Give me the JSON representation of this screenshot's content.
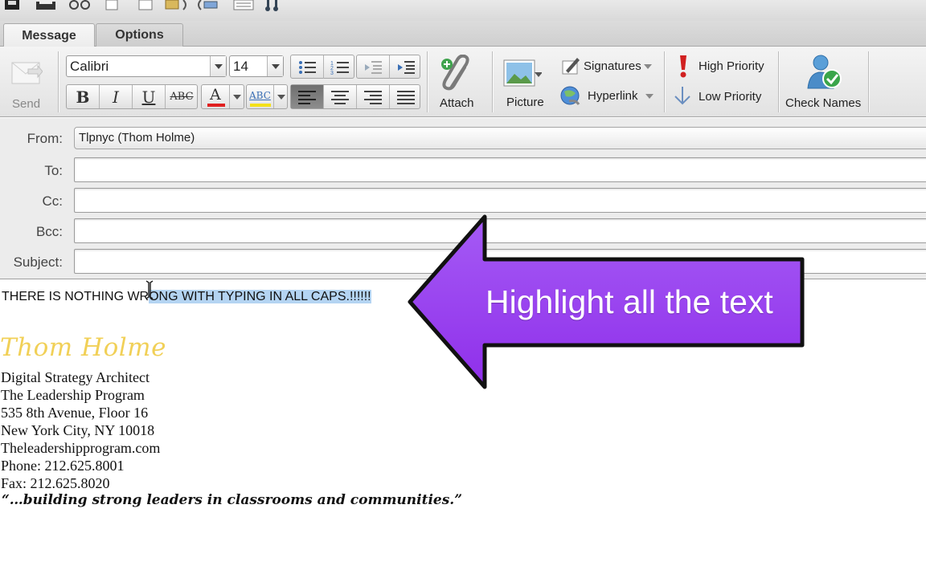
{
  "tabs": {
    "message": "Message",
    "options": "Options"
  },
  "ribbon": {
    "send": "Send",
    "font_name": "Calibri",
    "font_size": "14",
    "bold": "B",
    "italic": "I",
    "underline": "U",
    "strikethrough": "ABC",
    "font_color": "A",
    "highlight": "ABC",
    "attach": "Attach",
    "picture": "Picture",
    "signatures": "Signatures",
    "hyperlink": "Hyperlink",
    "high_priority": "High Priority",
    "low_priority": "Low Priority",
    "check_names": "Check Names",
    "colors": {
      "font_color_bar": "#e02020",
      "highlight_bar": "#f4e11a"
    }
  },
  "fields": {
    "from_label": "From:",
    "from_value": "Tlpnyc (Thom Holme)",
    "to_label": "To:",
    "cc_label": "Cc:",
    "bcc_label": "Bcc:",
    "subject_label": "Subject:"
  },
  "body": {
    "text_plain": "THERE IS NOTHING WR",
    "text_selected": "ONG WITH TYPING IN ALL CAPS.!!!!!!",
    "signature_name": "Thom Holme",
    "signature_lines": [
      "Digital Strategy Architect",
      "The Leadership Program",
      "535 8th Avenue, Floor 16",
      "New York City, NY 10018",
      "Theleadershipprogram.com",
      "Phone: 212.625.8001",
      "Fax: 212.625.8020"
    ],
    "signature_quote": "“…building strong leaders in classrooms and communities.”"
  },
  "callout": {
    "text": "Highlight all the text",
    "color": "#9b3ff0"
  },
  "icons": [
    "save-icon",
    "print-icon",
    "cut-icon",
    "copy-icon",
    "paste-icon",
    "paste-special-icon",
    "link-icon",
    "list-icon",
    "music-icon",
    "send-icon",
    "bullet-list-icon",
    "numbered-list-icon",
    "decrease-indent-icon",
    "increase-indent-icon",
    "align-left-icon",
    "align-center-icon",
    "align-right-icon",
    "justify-icon",
    "paperclip-icon",
    "picture-icon",
    "signature-pen-icon",
    "globe-link-icon",
    "exclamation-icon",
    "down-arrow-icon",
    "check-names-icon",
    "text-cursor-icon"
  ]
}
